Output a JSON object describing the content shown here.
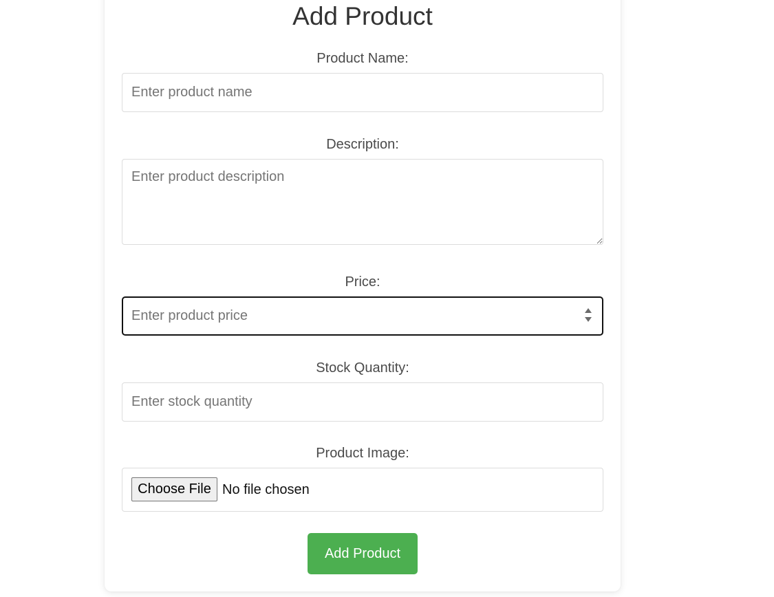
{
  "form": {
    "title": "Add Product",
    "product_name": {
      "label": "Product Name:",
      "placeholder": "Enter product name",
      "value": ""
    },
    "description": {
      "label": "Description:",
      "placeholder": "Enter product description",
      "value": ""
    },
    "price": {
      "label": "Price:",
      "placeholder": "Enter product price",
      "value": ""
    },
    "stock_quantity": {
      "label": "Stock Quantity:",
      "placeholder": "Enter stock quantity",
      "value": ""
    },
    "product_image": {
      "label": "Product Image:",
      "button_label": "Choose File",
      "status": "No file chosen"
    },
    "submit_label": "Add Product"
  },
  "colors": {
    "submit_background": "#4caf50",
    "submit_text": "#ffffff",
    "focused_border": "#111111",
    "field_border": "#dcdcdc"
  },
  "icons": {
    "price_spinner": "number-stepper-icon",
    "textarea_resize": "resize-grip-icon"
  }
}
